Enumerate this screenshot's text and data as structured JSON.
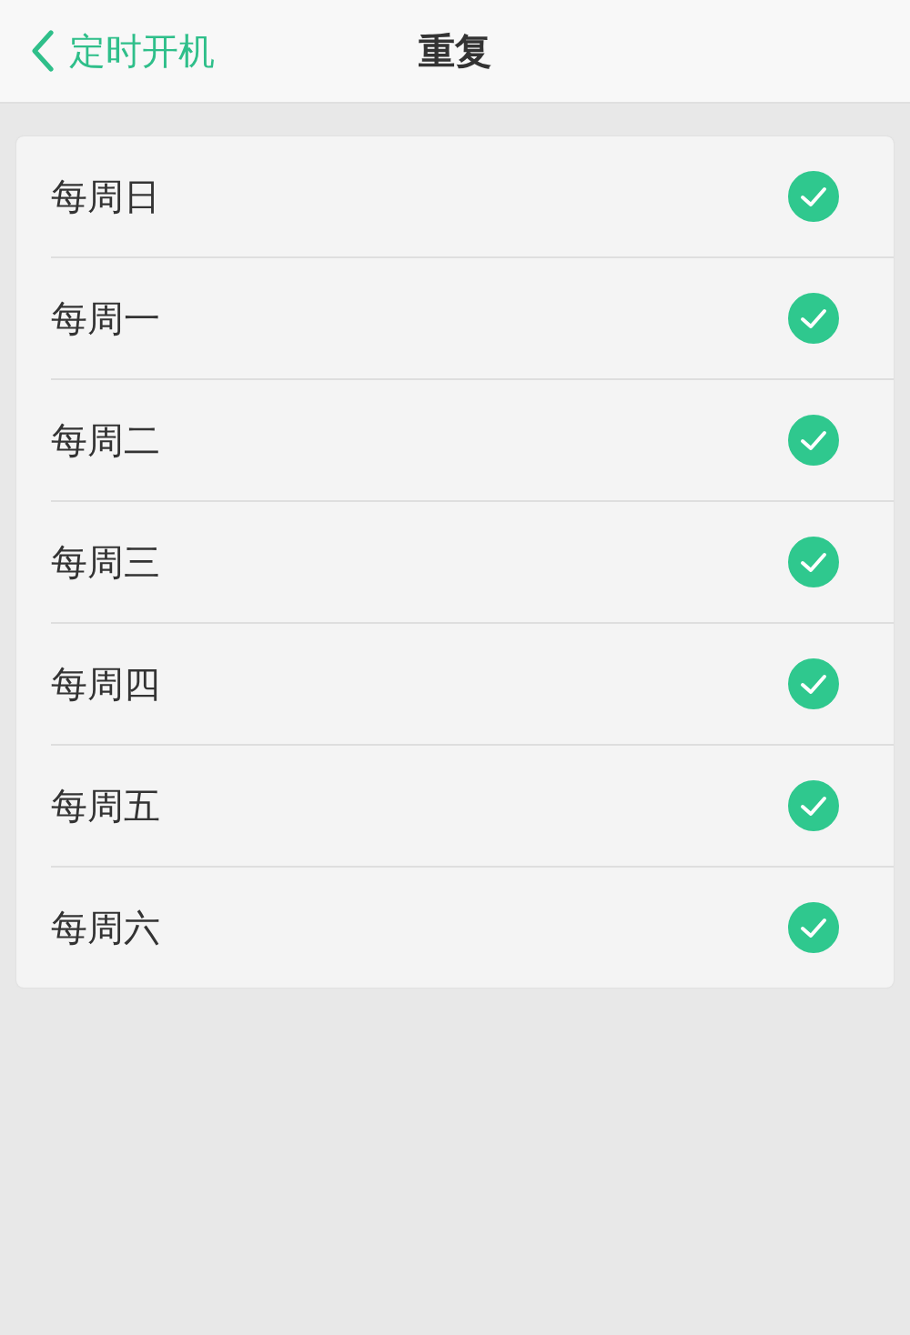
{
  "header": {
    "back_label": "定时开机",
    "title": "重复"
  },
  "days": [
    {
      "label": "每周日",
      "checked": true
    },
    {
      "label": "每周一",
      "checked": true
    },
    {
      "label": "每周二",
      "checked": true
    },
    {
      "label": "每周三",
      "checked": true
    },
    {
      "label": "每周四",
      "checked": true
    },
    {
      "label": "每周五",
      "checked": true
    },
    {
      "label": "每周六",
      "checked": true
    }
  ]
}
